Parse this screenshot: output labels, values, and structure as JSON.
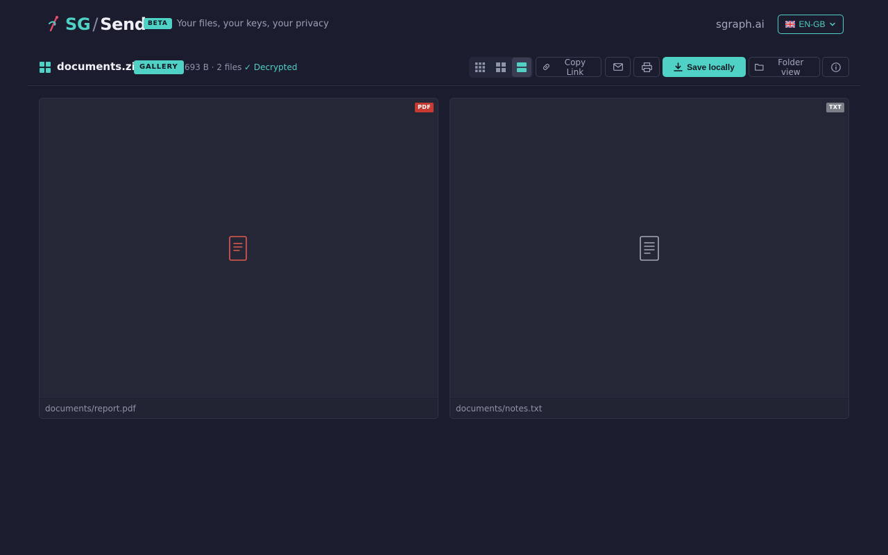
{
  "header": {
    "brand_prefix": "SG",
    "brand_slash": "/",
    "brand_suffix": "Send",
    "beta_label": "BETA",
    "tagline": "Your files, your keys, your privacy",
    "site_link": "sgraph.ai",
    "language": "EN-GB",
    "language_flag_icon": "uk-flag-icon"
  },
  "toolbar": {
    "file_name": "documents.zip",
    "mode_badge": "GALLERY",
    "meta": "693 B · 2 files",
    "status": "✓ Decrypted",
    "view_modes": [
      "small-grid",
      "large-grid",
      "list"
    ],
    "active_view": "list",
    "copy_link_label": "Copy Link",
    "save_label": "Save locally",
    "folder_view_label": "Folder view"
  },
  "files": [
    {
      "path": "documents/report.pdf",
      "type_badge": "PDF",
      "badge_color": "#c53a32",
      "icon_color": "#e05b4f",
      "icon": "document-icon"
    },
    {
      "path": "documents/notes.txt",
      "type_badge": "TXT",
      "badge_color": "#7b8088",
      "icon_color": "#a5a9b6",
      "icon": "document-icon"
    }
  ],
  "colors": {
    "accent": "#4fd1c5",
    "background": "#1b1c2e",
    "card": "#252636"
  }
}
